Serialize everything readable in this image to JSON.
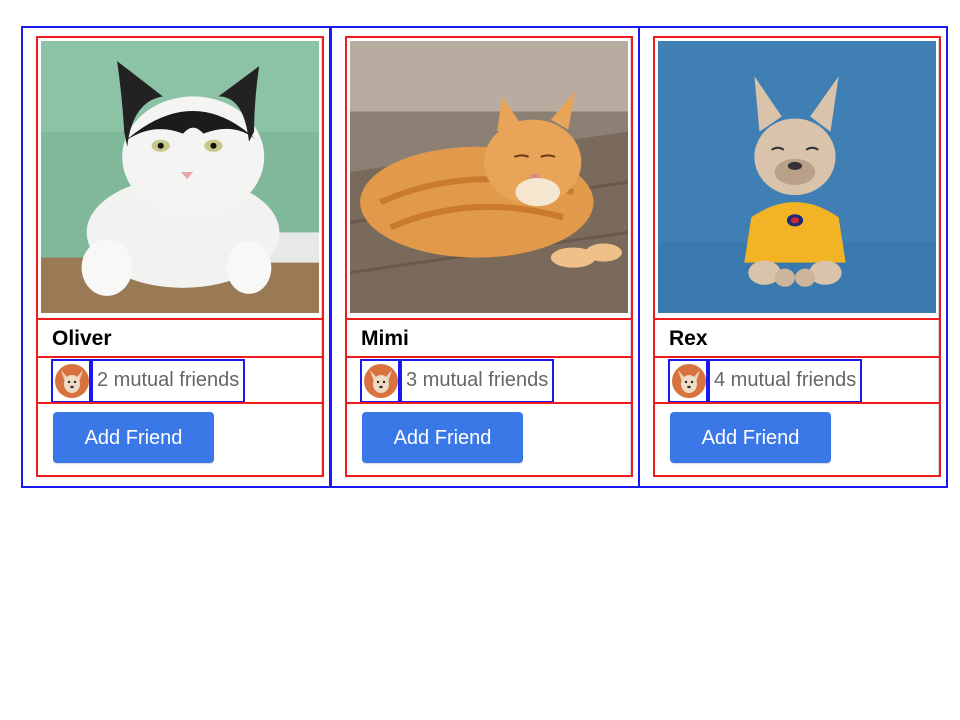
{
  "colors": {
    "outline_outer": "#1a1af0",
    "outline_inner": "#ee1c1c",
    "button_bg": "#3b78e7",
    "button_text": "#ffffff",
    "mutual_text": "#666666"
  },
  "cards": [
    {
      "name": "Oliver",
      "photo_icon": "black-and-white-cat-photo",
      "avatar_icon": "chihuahua-avatar",
      "mutual_friends": "2 mutual friends",
      "button_label": "Add Friend"
    },
    {
      "name": "Mimi",
      "photo_icon": "orange-tabby-cat-photo",
      "avatar_icon": "chihuahua-avatar",
      "mutual_friends": "3 mutual friends",
      "button_label": "Add Friend"
    },
    {
      "name": "Rex",
      "photo_icon": "french-bulldog-photo",
      "avatar_icon": "chihuahua-avatar",
      "mutual_friends": "4 mutual friends",
      "button_label": "Add Friend"
    }
  ]
}
